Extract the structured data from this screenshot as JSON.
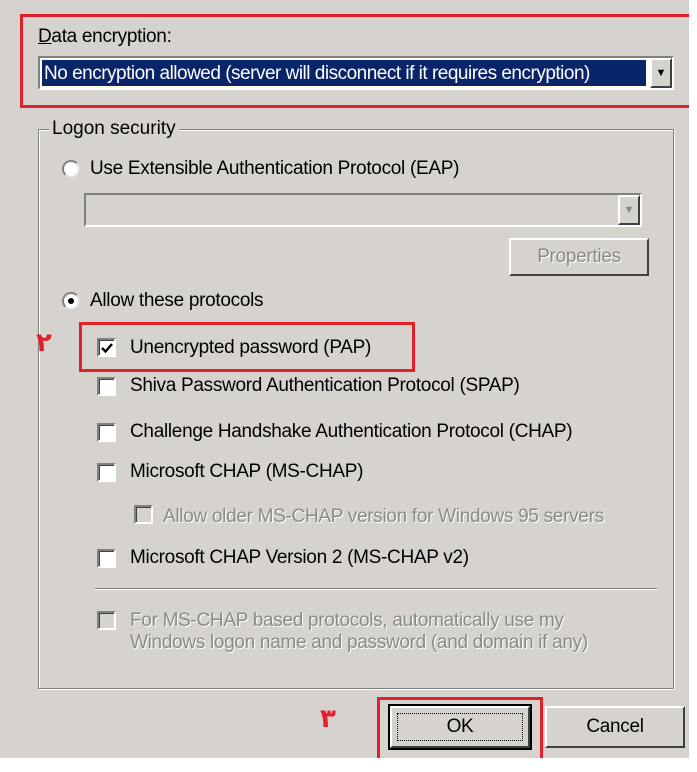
{
  "data_encryption": {
    "label": "Data encryption:",
    "selected": "No encryption allowed (server will disconnect if it requires encryption)"
  },
  "logon_security": {
    "title": "Logon security",
    "eap_radio_label": "Use Extensible Authentication Protocol (EAP)",
    "eap_selected": "",
    "properties_label": "Properties",
    "allow_radio_label": "Allow these protocols",
    "protocols": [
      {
        "label": "Unencrypted password (PAP)",
        "checked": true
      },
      {
        "label": "Shiva Password Authentication Protocol (SPAP)",
        "checked": false
      },
      {
        "label": "Challenge Handshake Authentication Protocol (CHAP)",
        "checked": false
      },
      {
        "label": "Microsoft CHAP (MS-CHAP)",
        "checked": false
      },
      {
        "label": "Allow older MS-CHAP version for Windows 95 servers",
        "checked": false,
        "disabled": true
      },
      {
        "label": "Microsoft CHAP Version 2 (MS-CHAP v2)",
        "checked": false
      }
    ],
    "auto_logon_line1": "For MS-CHAP based protocols, automatically use my",
    "auto_logon_line2": "Windows logon name and password (and domain if any)"
  },
  "buttons": {
    "ok": "OK",
    "cancel": "Cancel"
  },
  "annotations": {
    "step2": "٢",
    "step3": "٣"
  },
  "colors": {
    "dialog_bg": "#d6d3ce",
    "highlight": "#e3202a",
    "selection": "#0a246a"
  }
}
